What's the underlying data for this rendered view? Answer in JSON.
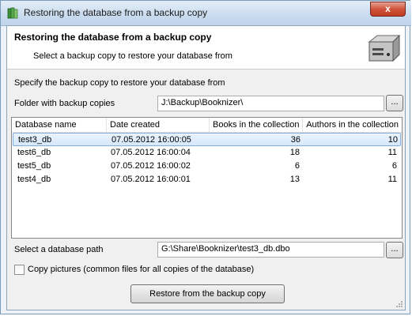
{
  "window": {
    "title": "Restoring the database from a backup copy",
    "close_label": "x",
    "icon": "books-icon"
  },
  "header": {
    "title": "Restoring the database from a backup copy",
    "subtitle": "Select a backup copy to restore your database from",
    "icon": "server-icon"
  },
  "form": {
    "instruction": "Specify the backup copy to restore your database from",
    "folder_label": "Folder with backup copies",
    "folder_value": "J:\\Backup\\Booknizer\\",
    "browse_label": "...",
    "db_path_label": "Select a database path",
    "db_path_value": "G:\\Share\\Booknizer\\test3_db.dbo",
    "copy_pictures_label": "Copy pictures (common files for all copies of the database)",
    "copy_pictures_checked": false,
    "restore_button": "Restore from the backup copy"
  },
  "table": {
    "columns": [
      "Database name",
      "Date created",
      "Books in the collection",
      "Authors in the collection"
    ],
    "rows": [
      {
        "name": "test3_db",
        "date": "07.05.2012 16:00:05",
        "books": "36",
        "authors": "10",
        "selected": true
      },
      {
        "name": "test6_db",
        "date": "07.05.2012 16:00:04",
        "books": "18",
        "authors": "11",
        "selected": false
      },
      {
        "name": "test5_db",
        "date": "07.05.2012 16:00:02",
        "books": "6",
        "authors": "6",
        "selected": false
      },
      {
        "name": "test4_db",
        "date": "07.05.2012 16:00:01",
        "books": "13",
        "authors": "11",
        "selected": false
      }
    ]
  }
}
